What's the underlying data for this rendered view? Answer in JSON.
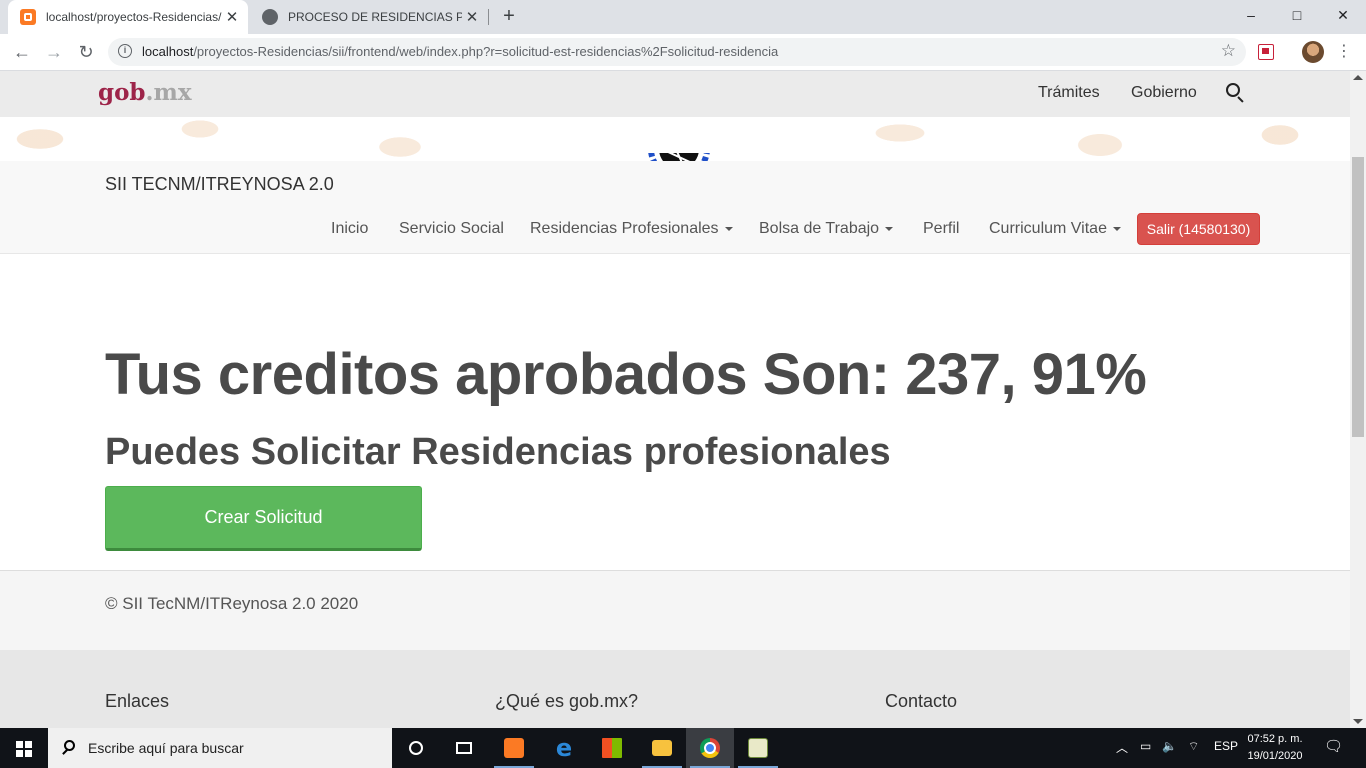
{
  "browser": {
    "tabs": [
      {
        "title": "localhost/proyectos-Residencias/",
        "active": true
      },
      {
        "title": "PROCESO DE RESIDENCIAS PROF",
        "active": false
      }
    ],
    "new_tab": "+",
    "window_controls": {
      "minimize": "–",
      "maximize": "□",
      "close": "✕"
    },
    "url_host": "localhost",
    "url_path": "/proyectos-Residencias/sii/frontend/web/index.php?r=solicitud-est-residencias%2Fsolicitud-residencia",
    "icons": [
      "back-icon",
      "forward-icon",
      "reload-icon",
      "info-icon",
      "star-icon",
      "extension-icon",
      "profile-avatar",
      "menu-icon"
    ]
  },
  "gob_header": {
    "logo_main": "gob",
    "logo_suffix": ".mx",
    "links": [
      "Trámites",
      "Gobierno"
    ]
  },
  "site_nav": {
    "brand": "SII TECNM/ITREYNOSA 2.0",
    "items": [
      {
        "label": "Inicio",
        "dropdown": false
      },
      {
        "label": "Servicio Social",
        "dropdown": false
      },
      {
        "label": "Residencias Profesionales",
        "dropdown": true
      },
      {
        "label": "Bolsa de Trabajo",
        "dropdown": true
      },
      {
        "label": "Perfil",
        "dropdown": false
      },
      {
        "label": "Curriculum Vitae",
        "dropdown": true
      }
    ],
    "logout": "Salir (14580130)"
  },
  "main": {
    "title": "Tus creditos aprobados Son: 237, 91%",
    "subtitle": "Puedes Solicitar Residencias profesionales",
    "create_button": "Crear Solicitud"
  },
  "footer": {
    "copyright": "© SII TecNM/ITReynosa 2.0 2020",
    "columns": [
      "Enlaces",
      "¿Qué es gob.mx?",
      "Contacto"
    ]
  },
  "taskbar": {
    "search_placeholder": "Escribe aquí para buscar",
    "language": "ESP",
    "time": "07:52 p. m.",
    "date": "19/01/2020"
  },
  "colors": {
    "gob_brand": "#9d2449",
    "success": "#5cb85c",
    "danger": "#d9534f",
    "tab_bar": "#dee1e6"
  }
}
